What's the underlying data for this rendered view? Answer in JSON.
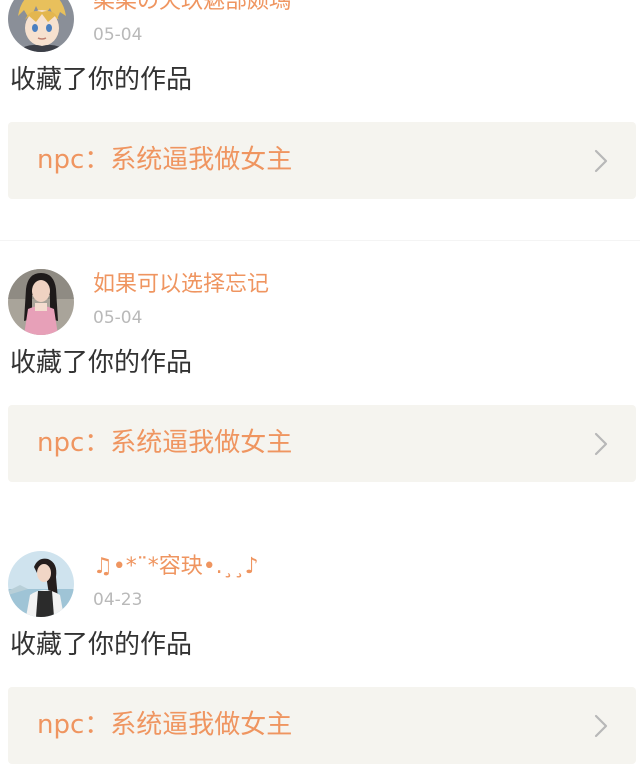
{
  "notifications": [
    {
      "username": "柔柔の天玖魅部颇瑪",
      "time": "05-04",
      "action": "收藏了你的作品",
      "work_title": "npc：系统逼我做女主",
      "avatar": "anime-boy-avatar"
    },
    {
      "username": "如果可以选择忘记",
      "time": "05-04",
      "action": "收藏了你的作品",
      "work_title": "npc：系统逼我做女主",
      "avatar": "girl-photo-avatar"
    },
    {
      "username": "♫•*¨*容玦•.¸¸♪",
      "time": "04-23",
      "action": "收藏了你的作品",
      "work_title": "npc：系统逼我做女主",
      "avatar": "girl-outdoor-avatar"
    }
  ],
  "colors": {
    "accent": "#ef9560",
    "timestamp": "#b9b9b9",
    "action_text": "#333333",
    "link_background": "#f5f4ef",
    "separator": "#f4f4f4"
  }
}
